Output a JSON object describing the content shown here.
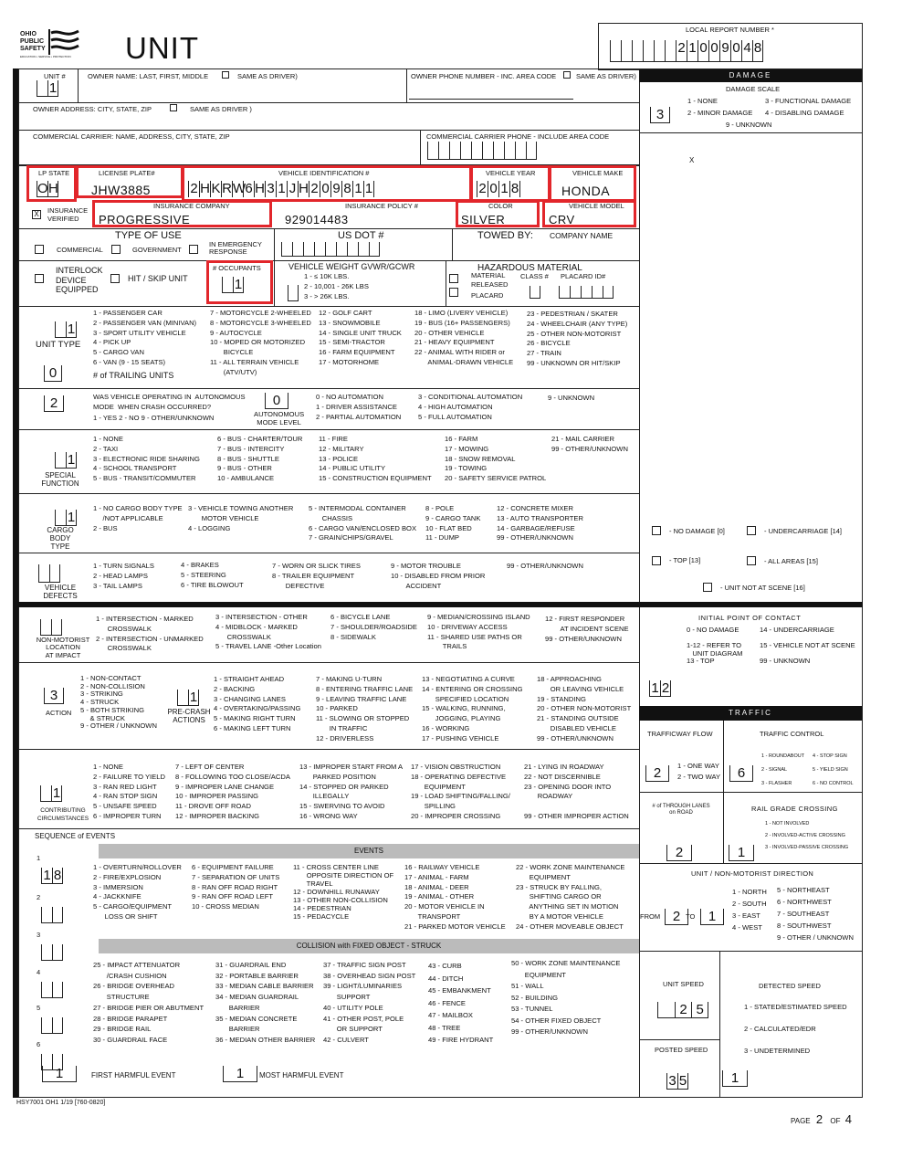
{
  "header": {
    "logo_text": "OHIO PUBLIC SAFETY",
    "logo_sub": "EDUCATION • SERVICE • PROTECTION",
    "title": "UNIT",
    "local_report_label": "LOCAL REPORT NUMBER *",
    "local_report_number": "21009048"
  },
  "owner": {
    "unit_label": "UNIT #",
    "unit_value": "1",
    "name_label": "OWNER NAME: LAST, FIRST, MIDDLE",
    "same_as_driver": "SAME AS DRIVER)",
    "phone_label": "OWNER PHONE NUMBER - INC. AREA CODE",
    "phone_same": "SAME AS DRIVER)",
    "address_label": "OWNER ADDRESS: CITY, STATE, ZIP",
    "address_same": "SAME AS DRIVER )",
    "carrier_label": "COMMERCIAL CARRIER: NAME, ADDRESS, CITY, STATE, ZIP",
    "carrier_phone_label": "COMMERCIAL CARRIER PHONE - INCLUDE AREA CODE"
  },
  "vehicle": {
    "lp_state_label": "LP STATE",
    "lp_state": "OH",
    "plate_label": "LICENSE PLATE#",
    "plate": "JHW3885",
    "vin_label": "VEHICLE IDENTIFICATION #",
    "vin": "2HKRW6H31JH209811",
    "year_label": "VEHICLE YEAR",
    "year": "2018",
    "make_label": "VEHICLE MAKE",
    "make": "HONDA",
    "ins_verified_label": "INSURANCE VERIFIED",
    "ins_verified_mark": "X",
    "ins_company_label": "INSURANCE COMPANY",
    "ins_company": "PROGRESSIVE",
    "policy_label": "INSURANCE POLICY #",
    "policy": "929014483",
    "color_label": "COLOR",
    "color": "SILVER",
    "model_label": "VEHICLE MODEL",
    "model": "CRV",
    "highlight_color": "#e2262b"
  },
  "use": {
    "type_label": "TYPE OF USE",
    "commercial": "COMMERCIAL",
    "government": "GOVERNMENT",
    "emergency": "IN EMERGENCY RESPONSE",
    "usdot_label": "US DOT #",
    "towed_label": "TOWED BY:",
    "company_label": "COMPANY NAME"
  },
  "interlock": {
    "label": "INTERLOCK DEVICE EQUIPPED",
    "hit_skip": "HIT / SKIP UNIT",
    "occupants_label": "# OCCUPANTS",
    "occupants": "1",
    "weight_label": "VEHICLE WEIGHT GVWR/GCWR",
    "weight_opts": "1 - ≤ 10K LBS.\n2 - 10,001 - 26K LBS\n3 - > 26K LBS.",
    "hazmat_label": "HAZARDOUS MATERIAL",
    "hazmat_released": "MATERIAL\nRELEASED",
    "hazmat_placard": "PLACARD",
    "class_label": "CLASS #",
    "placard_id_label": "PLACARD ID#"
  },
  "unit_type": {
    "label": "UNIT TYPE",
    "value": "1",
    "trailing_label": "# of TRAILING UNITS",
    "trailing_value": "0",
    "options": [
      "1 - PASSENGER CAR\n2 - PASSENGER VAN (MINIVAN)\n3 - SPORT UTILITY VEHICLE\n4 - PICK UP\n5 - CARGO VAN\n6 - VAN (9 - 15 SEATS)",
      "7 - MOTORCYCLE 2-WHEELED\n8 - MOTORCYCLE 3-WHEELED\n9 - AUTOCYCLE\n10 - MOPED OR MOTORIZED\n       BICYCLE\n11 - ALL TERRAIN VEHICLE\n       (ATV/UTV)",
      "12 - GOLF CART\n13 - SNOWMOBILE\n14 - SINGLE UNIT TRUCK\n15 - SEMI-TRACTOR\n16 - FARM EQUIPMENT\n17 - MOTORHOME",
      "18 - LIMO (LIVERY VEHICLE)\n19 - BUS (16+ PASSENGERS)\n20 - OTHER VEHICLE\n21 - HEAVY EQUIPMENT\n22 - ANIMAL WITH RIDER or\n       ANIMAL-DRAWN VEHICLE",
      "23 - PEDESTRIAN / SKATER\n24 - WHEELCHAIR (ANY TYPE)\n25 - OTHER NON-MOTORIST\n26 - BICYCLE\n27 - TRAIN\n99 - UNKNOWN OR HIT/SKIP"
    ]
  },
  "autonomous": {
    "value": "2",
    "question": "WAS VEHICLE OPERATING IN  AUTONOMOUS\nMODE  WHEN CRASH OCCURRED?",
    "answers": "1 - YES   2 - NO   9 - OTHER/UNKNOWN",
    "level_value": "0",
    "level_label": "AUTONOMOUS\nMODE LEVEL",
    "options": [
      "0 - NO AUTOMATION\n1 - DRIVER ASSISTANCE\n2 - PARTIAL AUTOMATION",
      "3 - CONDITIONAL AUTOMATION\n4 - HIGH AUTOMATION\n5 - FULL AUTOMATION",
      "9 - UNKNOWN"
    ]
  },
  "special_function": {
    "label": "SPECIAL\nFUNCTION",
    "value": "1",
    "options": [
      "1 - NONE\n2 - TAXI\n3 - ELECTRONIC RIDE SHARING\n4 - SCHOOL TRANSPORT\n5 - BUS - TRANSIT/COMMUTER",
      "6 - BUS - CHARTER/TOUR\n7 - BUS - INTERCITY\n8 - BUS - SHUTTLE\n9 - BUS - OTHER\n10 - AMBULANCE",
      "11 - FIRE\n12 - MILITARY\n13 - POLICE\n14 - PUBLIC UTILITY\n15 - CONSTRUCTION EQUIPMENT",
      "16 - FARM\n17 - MOWING\n18 - SNOW REMOVAL\n19 - TOWING\n20 - SAFETY SERVICE PATROL",
      "21 - MAIL CARRIER\n99 - OTHER/UNKNOWN"
    ]
  },
  "cargo_body": {
    "label": "CARGO\nBODY\nTYPE",
    "value": "1",
    "options": [
      "1 - NO CARGO BODY TYPE\n     /NOT APPLICABLE\n2 - BUS",
      "3 - VEHICLE TOWING ANOTHER\n       MOTOR VEHICLE\n4 - LOGGING",
      "5 - INTERMODAL CONTAINER\n       CHASSIS\n6 - CARGO VAN/ENCLOSED BOX\n7 - GRAIN/CHIPS/GRAVEL",
      "8 - POLE\n9 - CARGO TANK\n10 - FLAT BED\n11 - DUMP",
      "12 - CONCRETE MIXER\n13 - AUTO TRANSPORTER\n14 - GARBAGE/REFUSE\n99 - OTHER/UNKNOWN"
    ]
  },
  "defects": {
    "label": "VEHICLE\nDEFECTS",
    "value": "",
    "options": [
      "1 - TURN SIGNALS\n2 - HEAD LAMPS\n3 - TAIL LAMPS",
      "4 - BRAKES\n5 - STEERING\n6 - TIRE BLOWOUT",
      "7 - WORN OR SLICK TIRES\n8 - TRAILER EQUIPMENT\n       DEFECTIVE",
      "9 - MOTOR TROUBLE\n10 - DISABLED FROM PRIOR\n        ACCIDENT",
      "99 - OTHER/UNKNOWN"
    ]
  },
  "non_motorist": {
    "label": "NON-MOTORIST\nLOCATION\nAT IMPACT",
    "value": "",
    "options": [
      "1 - INTERSECTION - MARKED\n      CROSSWALK\n2 - INTERSECTION - UNMARKED\n      CROSSWALK",
      "3 - INTERSECTION - OTHER\n4 - MIDBLOCK - MARKED\n      CROSSWALK\n5 - TRAVEL LANE -Other Location",
      "6 - BICYCLE LANE\n7 - SHOULDER/ROADSIDE\n8 - SIDEWALK",
      "9 - MEDIAN/CROSSING ISLAND\n10 - DRIVEWAY ACCESS\n11 - SHARED USE PATHS OR\n        TRAILS",
      "12 - FIRST RESPONDER\n        AT INCIDENT SCENE\n99 - OTHER/UNKNOWN"
    ]
  },
  "action": {
    "label": "ACTION",
    "value": "3",
    "options": "1 - NON-CONTACT\n2 - NON-COLLISION\n3 - STRIKING\n4 - STRUCK\n5 - BOTH STRIKING\n     & STRUCK\n9 - OTHER / UNKNOWN",
    "precrash_label": "PRE-CRASH\nACTIONS",
    "precrash_value": "1",
    "precrash_options": [
      "1 - STRAIGHT AHEAD\n2 - BACKING\n3 - CHANGING LANES\n4 - OVERTAKING/PASSING\n5 - MAKING RIGHT TURN\n6 - MAKING LEFT TURN",
      "7 - MAKING U-TURN\n8 - ENTERING TRAFFIC LANE\n9 - LEAVING TRAFFIC LANE\n10 - PARKED\n11 - SLOWING OR STOPPED\n       IN TRAFFIC\n12 - DRIVERLESS",
      "13 - NEGOTIATING A CURVE\n14 - ENTERING OR CROSSING\n       SPECIFIED LOCATION\n15 - WALKING, RUNNING,\n       JOGGING, PLAYING\n16 - WORKING\n17 - PUSHING VEHICLE",
      "18 - APPROACHING\n       OR LEAVING VEHICLE\n19 - STANDING\n20 - OTHER NON-MOTORIST\n21 - STANDING OUTSIDE\n       DISABLED VEHICLE\n99 - OTHER/UNKNOWN"
    ]
  },
  "contributing": {
    "label": "CONTRIBUTING\nCIRCUMSTANCES",
    "value": "1",
    "options": [
      "1 - NONE\n2 - FAILURE TO YIELD\n3 - RAN RED LIGHT\n4 - RAN STOP SIGN\n5 - UNSAFE SPEED\n6 - IMPROPER TURN",
      "7 - LEFT OF CENTER\n8 - FOLLOWING TOO CLOSE/ACDA\n9 - IMPROPER LANE CHANGE\n10 - IMPROPER PASSING\n11 - DROVE OFF ROAD\n12 - IMPROPER BACKING",
      "13 - IMPROPER START FROM A\n       PARKED POSITION\n14 - STOPPED OR PARKED\n       ILLEGALLY\n15 - SWERVING TO AVOID\n16 - WRONG WAY",
      "17 - VISION OBSTRUCTION\n18 - OPERATING DEFECTIVE\n       EQUIPMENT\n19 - LOAD SHIFTING/FALLING/\n       SPILLING\n20 - IMPROPER CROSSING",
      "21 - LYING IN ROADWAY\n22 - NOT DISCERNIBLE\n23 - OPENING DOOR INTO\n       ROADWAY\n\n99 - OTHER IMPROPER ACTION"
    ]
  },
  "sequence": {
    "label": "SEQUENCE of EVENTS",
    "events_header": "EVENTS",
    "fixed_header": "COLLISION with FIXED OBJECT - STRUCK",
    "slots": [
      {
        "n": "1",
        "v": "18"
      },
      {
        "n": "2",
        "v": ""
      },
      {
        "n": "3",
        "v": ""
      },
      {
        "n": "4",
        "v": ""
      },
      {
        "n": "5",
        "v": ""
      },
      {
        "n": "6",
        "v": ""
      }
    ],
    "events": [
      "1 - OVERTURN/ROLLOVER\n2 - FIRE/EXPLOSION\n3 - IMMERSION\n4 - JACKKNIFE\n5 - CARGO/EQUIPMENT\n      LOSS OR SHIFT",
      "6 - EQUIPMENT FAILURE\n7 - SEPARATION OF UNITS\n8 - RAN OFF ROAD RIGHT\n9 - RAN OFF ROAD LEFT\n10 - CROSS MEDIAN",
      "11 - CROSS CENTER LINE\n       OPPOSITE DIRECTION OF\n       TRAVEL\n12 - DOWNHILL RUNAWAY\n13 - OTHER NON-COLLISION\n14 - PEDESTRIAN\n15 - PEDACYCLE",
      "16 - RAILWAY VEHICLE\n17 - ANIMAL - FARM\n18 - ANIMAL - DEER\n19 - ANIMAL - OTHER\n20 - MOTOR VEHICLE IN\n       TRANSPORT\n21 - PARKED MOTOR VEHICLE",
      "22 - WORK ZONE MAINTENANCE\n       EQUIPMENT\n23 - STRUCK BY FALLING,\n       SHIFTING CARGO OR\n       ANYTHING SET IN MOTION\n       BY A MOTOR VEHICLE\n24 - OTHER MOVEABLE OBJECT"
    ],
    "fixed": [
      "25 - IMPACT ATTENUATOR\n       /CRASH CUSHION\n26 - BRIDGE OVERHEAD\n       STRUCTURE\n27 - BRIDGE PIER OR ABUTMENT\n28 - BRIDGE PARAPET\n29 - BRIDGE RAIL\n30 - GUARDRAIL FACE",
      "31 - GUARDRAIL END\n32 - PORTABLE BARRIER\n33 - MEDIAN CABLE BARRIER\n34 - MEDIAN GUARDRAIL\n       BARRIER\n35 - MEDIAN CONCRETE\n       BARRIER\n36 - MEDIAN OTHER BARRIER",
      "37 - TRAFFIC SIGN POST\n38 - OVERHEAD SIGN POST\n39 - LIGHT/LUMINARIES\n       SUPPORT\n40 - UTILITY POLE\n41 - OTHER POST, POLE\n       OR SUPPORT\n42 - CULVERT",
      "43 - CURB\n44 - DITCH\n45 - EMBANKMENT\n46 - FENCE\n47 - MAILBOX\n48 - TREE\n49 - FIRE HYDRANT",
      "50 - WORK ZONE MAINTENANCE\n       EQUIPMENT\n51 - WALL\n52 - BUILDING\n53 - TUNNEL\n54 - OTHER FIXED OBJECT\n99 - OTHER/UNKNOWN"
    ],
    "first_harmful_value": "1",
    "first_harmful_label": "FIRST HARMFUL EVENT",
    "most_harmful_value": "1",
    "most_harmful_label": "MOST HARMFUL EVENT"
  },
  "damage": {
    "header": "DAMAGE",
    "scale_label": "DAMAGE SCALE",
    "value": "3",
    "options": [
      "1 - NONE\n2 - MINOR DAMAGE",
      "3 - FUNCTIONAL DAMAGE\n4 - DISABLING DAMAGE"
    ],
    "unknown": "9 - UNKNOWN",
    "diagram_mark": "X",
    "no_damage": "- NO DAMAGE [0]",
    "undercarriage": "- UNDERCARRIAGE  [14]",
    "top": "- TOP [13]",
    "all_areas": "- ALL AREAS   [15]",
    "not_at_scene": "- UNIT NOT AT SCENE  [16]"
  },
  "contact": {
    "label": "INITIAL POINT OF CONTACT",
    "options": [
      "0 - NO DAMAGE\n\n1-12 - REFER TO\n   UNIT DIAGRAM\n13 - TOP",
      "14 - UNDERCARRIAGE\n\n15 - VEHICLE NOT AT SCENE\n\n99 - UNKNOWN"
    ],
    "value": "12"
  },
  "traffic": {
    "header": "TRAFFIC",
    "flow_label": "TRAFFICWAY FLOW",
    "flow_value": "2",
    "flow_options": "1 - ONE WAY\n2 - TWO WAY",
    "control_label": "TRAFFIC CONTROL",
    "control_value": "6",
    "control_options": [
      "1 - ROUNDABOUT\n2 - SIGNAL\n3 - FLASHER",
      "4 - STOP SIGN\n5 - YIELD SIGN\n6 - NO CONTROL"
    ],
    "lanes_label": "# of THROUGH LANES\non ROAD",
    "lanes_value": "2",
    "rail_label": "RAIL GRADE CROSSING",
    "rail_value": "1",
    "rail_options": "1 - NOT INVOLVED\n2 - INVOLVED-ACTIVE CROSSING\n3 - INVOLVED-PASSIVE CROSSING"
  },
  "direction": {
    "label": "UNIT / NON-MOTORIST DIRECTION",
    "from_label": "FROM",
    "to_label": "TO",
    "from_value": "2",
    "to_value": "1",
    "options": [
      "1 - NORTH\n2 - SOUTH\n3 - EAST\n4 - WEST",
      "5 - NORTHEAST\n6 - NORTHWEST\n7 - SOUTHEAST\n8 - SOUTHWEST\n9 - OTHER / UNKNOWN"
    ]
  },
  "speed": {
    "unit_label": "UNIT SPEED",
    "unit_value": "25",
    "posted_label": "POSTED SPEED",
    "posted_value": "35",
    "detected_label": "DETECTED SPEED",
    "detected_options": "1 - STATED/ESTIMATED SPEED\n\n2 - CALCULATED/EDR\n\n3 - UNDETERMINED",
    "detected_value": "1"
  },
  "footer": {
    "form_id": "HSY7001 OH1 1/19 [760-0820]",
    "page_label": "PAGE",
    "page": "2",
    "of_label": "OF",
    "total": "4"
  }
}
